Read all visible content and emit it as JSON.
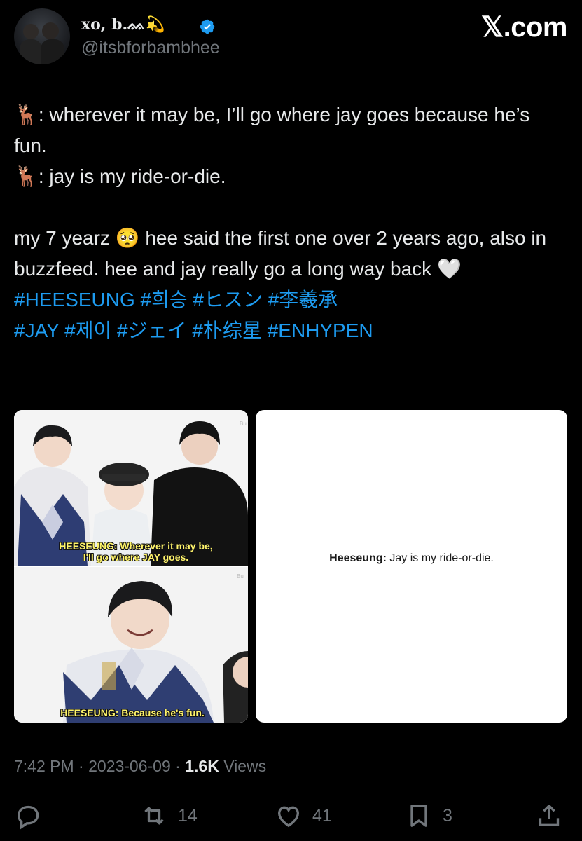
{
  "user": {
    "display_name": "xo, b.ᨐ💫",
    "handle": "@itsbforbambhee",
    "verified": true
  },
  "brand": "𝕏.com",
  "tweet": {
    "line1": "🦌: wherever it may be, I’ll go where jay goes because he’s fun.",
    "line2": "🦌: jay is my ride-or-die.",
    "line3": "my 7 yearz 🥺 hee said the first one over 2 years ago, also in buzzfeed. hee and jay really go a long way back 🤍",
    "hashtags_line1": "#HEESEUNG #희승 #ヒスン #李羲承",
    "hashtags_line2": "#JAY #제이 #ジェイ #朴综星 #ENHYPEN"
  },
  "media": {
    "left_caption_top_1": "HEESEUNG: Wherever it may be,",
    "left_caption_top_2": "I'll go where JAY goes.",
    "left_caption_bottom": "HEESEUNG: Because he's fun.",
    "right_quote_speaker": "Heeseung:",
    "right_quote_text": " Jay is my ride-or-die."
  },
  "meta": {
    "time": "7:42 PM",
    "sep1": " · ",
    "date": "2023-06-09",
    "sep2": " · ",
    "views_count": "1.6K",
    "views_label": " Views"
  },
  "actions": {
    "reply_icon": "reply-icon",
    "retweet_count": "14",
    "like_count": "41",
    "bookmark_count": "3",
    "share_icon": "share-icon"
  },
  "colors": {
    "background": "#000000",
    "text": "#e7e9ea",
    "muted": "#71767b",
    "link": "#1d9bf0",
    "verified": "#1d9bf0",
    "caption": "#fff46b"
  }
}
